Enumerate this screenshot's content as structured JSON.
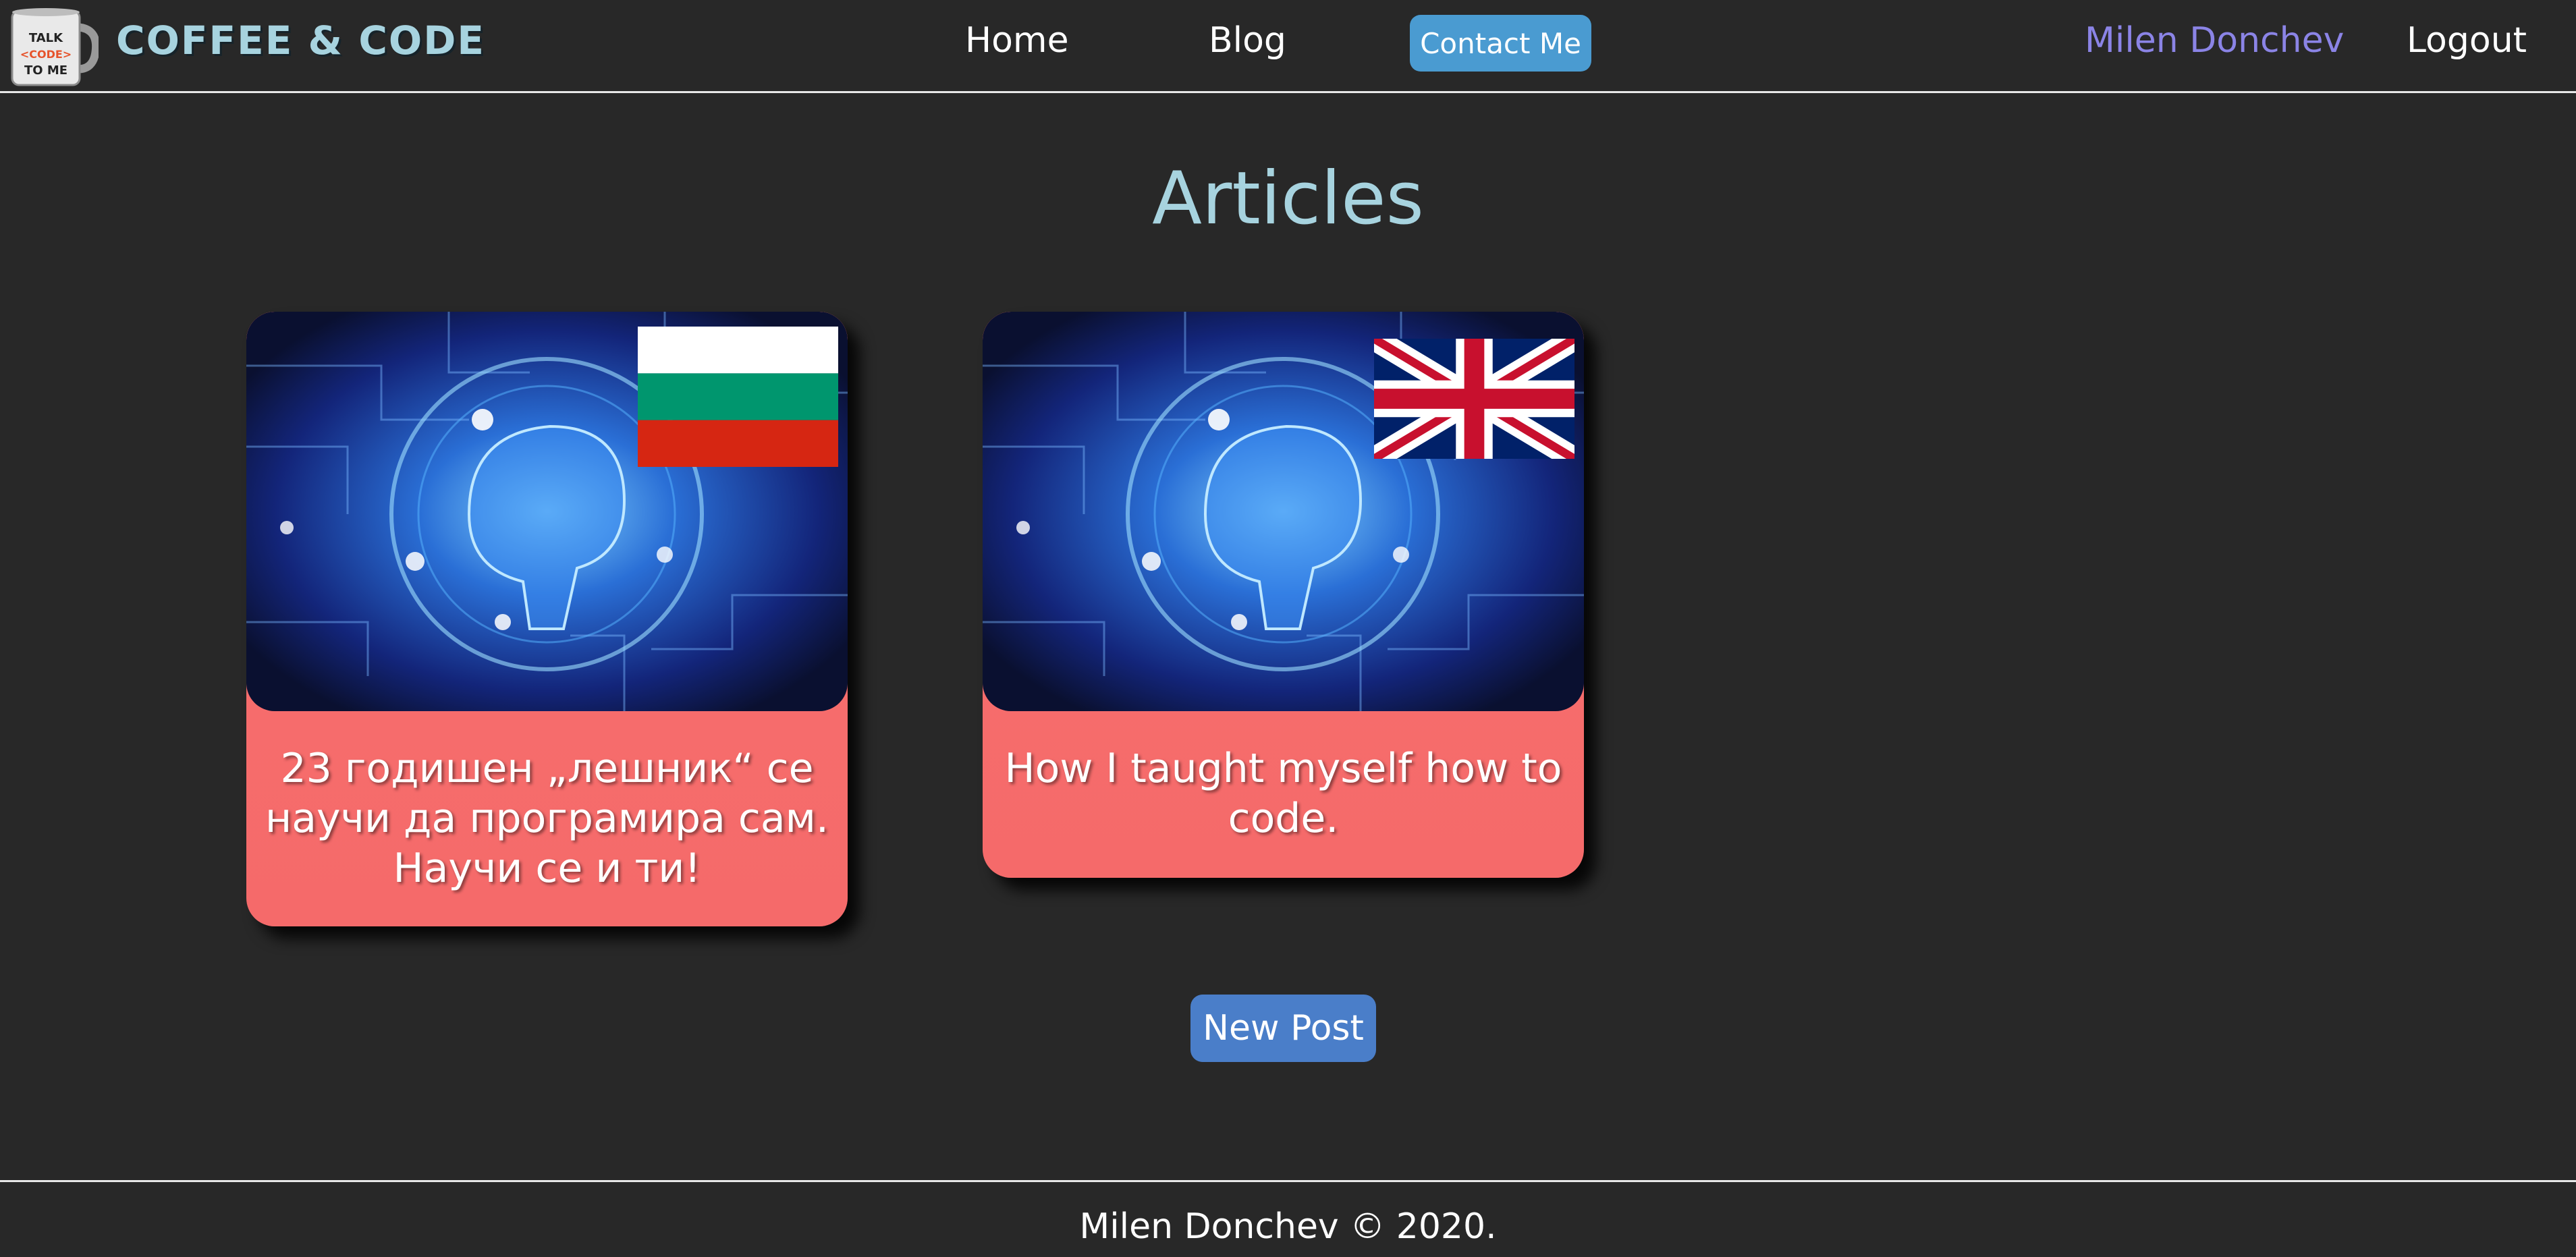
{
  "header": {
    "brand": "COFFEE & CODE",
    "logo_text": [
      "TALK",
      "<CODE>",
      "TO ME"
    ],
    "nav": {
      "home": "Home",
      "blog": "Blog",
      "contact": "Contact Me"
    },
    "user_name": "Milen Donchev",
    "logout": "Logout"
  },
  "main": {
    "title": "Articles",
    "articles": [
      {
        "title": "23 годишен „лешник“ се научи да програмира сам. Научи се и ти!",
        "flag": "bulgaria-flag"
      },
      {
        "title": "How I taught myself how to code.",
        "flag": "uk-flag"
      }
    ],
    "new_post": "New Post"
  },
  "footer": {
    "text": "Milen Donchev © 2020."
  },
  "colors": {
    "background": "#282828",
    "brand": "#a7d3df",
    "accent_contact": "#4a9bd1",
    "user_link": "#8b84e6",
    "card": "#f56a6a",
    "new_post": "#4a7ec9"
  }
}
